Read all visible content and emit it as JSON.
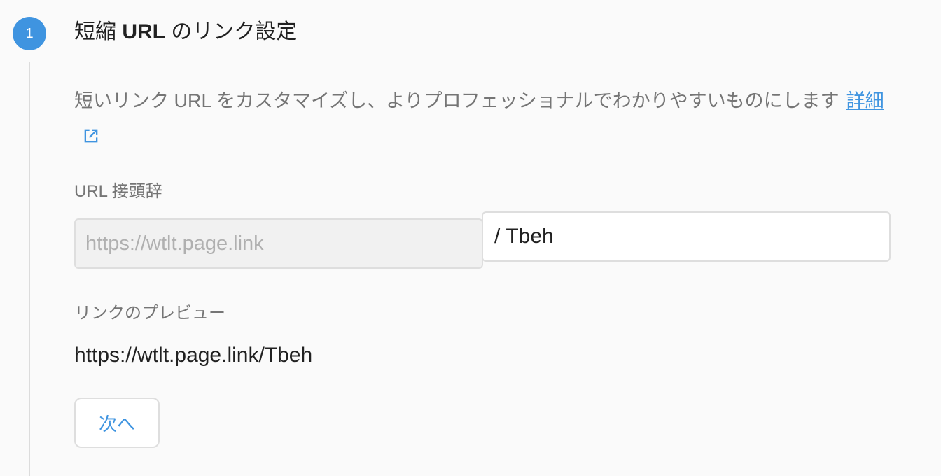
{
  "step": {
    "number": "1",
    "title_prefix": "短縮",
    "title_bold": "URL",
    "title_suffix": "のリンク設定"
  },
  "description": {
    "text": "短いリンク URL をカスタマイズし、よりプロフェッショナルでわかりやすいものにします",
    "details_link": "詳細",
    "external_icon": "open-in-new-icon"
  },
  "url_prefix": {
    "label": "URL 接頭辞",
    "placeholder": "https://wtlt.page.link",
    "separator": "/",
    "suffix_value": "Tbeh"
  },
  "preview": {
    "label": "リンクのプレビュー",
    "url": "https://wtlt.page.link/Tbeh"
  },
  "actions": {
    "next_label": "次へ"
  },
  "colors": {
    "accent": "#3f94e0",
    "muted_text": "#757575",
    "border": "#dedede"
  }
}
